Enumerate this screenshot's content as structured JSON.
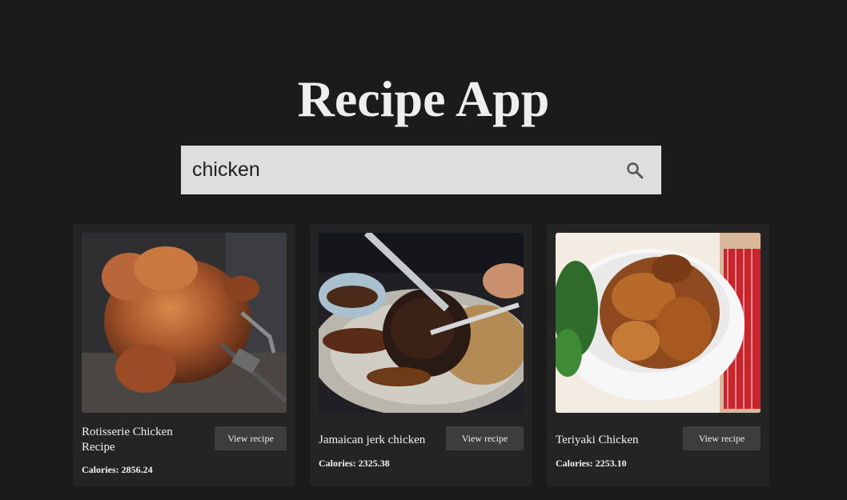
{
  "app": {
    "title": "Recipe App"
  },
  "search": {
    "value": "chicken",
    "icon": "search-icon"
  },
  "recipes": [
    {
      "name": "Rotisserie Chicken Recipe",
      "button": "View recipe",
      "calories": "Calories: 2856.24"
    },
    {
      "name": "Jamaican jerk chicken",
      "button": "View recipe",
      "calories": "Calories: 2325.38"
    },
    {
      "name": "Teriyaki Chicken",
      "button": "View recipe",
      "calories": "Calories: 2253.10"
    }
  ],
  "colors": {
    "background": "#1b1b1b",
    "card": "#242424",
    "search_bg": "#dedede",
    "button_bg": "#3d3d3d"
  }
}
